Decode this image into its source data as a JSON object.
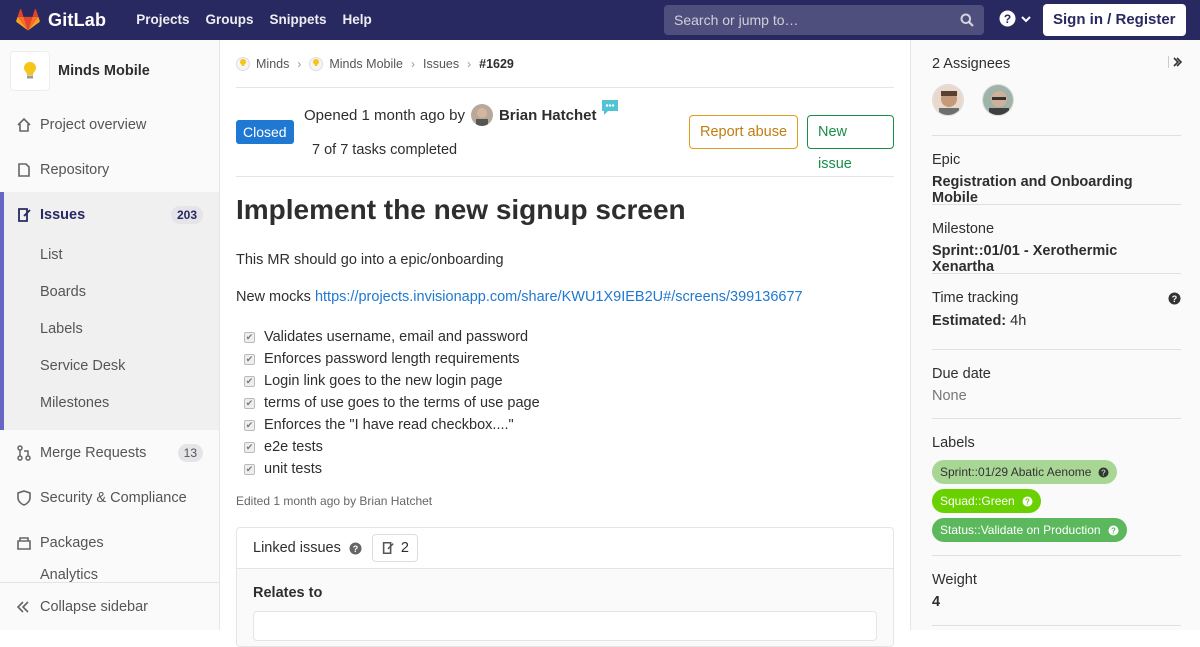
{
  "topbar": {
    "brand": "GitLab",
    "nav": [
      "Projects",
      "Groups",
      "Snippets",
      "Help"
    ],
    "search_placeholder": "Search or jump to…",
    "signin": "Sign in / Register"
  },
  "sidebar": {
    "project_name": "Minds Mobile",
    "items": [
      {
        "label": "Project overview",
        "icon": "home-icon"
      },
      {
        "label": "Repository",
        "icon": "doc-icon"
      }
    ],
    "issues": {
      "label": "Issues",
      "count": "203",
      "sub": [
        "List",
        "Boards",
        "Labels",
        "Service Desk",
        "Milestones"
      ]
    },
    "items_after": [
      {
        "label": "Merge Requests",
        "count": "13",
        "icon": "merge-request-icon"
      },
      {
        "label": "Security & Compliance",
        "icon": "shield-icon"
      },
      {
        "label": "Packages",
        "icon": "package-icon"
      }
    ],
    "partial_label": "Analytics",
    "collapse": "Collapse sidebar"
  },
  "breadcrumb": [
    "Minds",
    "Minds Mobile",
    "Issues",
    "#1629"
  ],
  "issue": {
    "status": "Closed",
    "opened_prefix": "Opened 1 month ago by",
    "author": "Brian Hatchet",
    "tasks": "7 of 7 tasks completed",
    "report_abuse": "Report abuse",
    "new_issue": "New issue",
    "title": "Implement the new signup screen",
    "desc1": "This MR should go into a epic/onboarding",
    "desc2_prefix": "New mocks ",
    "desc2_link": "https://projects.invisionapp.com/share/KWU1X9IEB2U#/screens/399136677",
    "task_items": [
      "Validates username, email and password",
      "Enforces password length requirements",
      "Login link goes to the new login page",
      "terms of use goes to the terms of use page",
      "Enforces the \"I have read checkbox....\"",
      "e2e tests",
      "unit tests"
    ],
    "edited": "Edited 1 month ago by Brian Hatchet",
    "linked_label": "Linked issues",
    "linked_count": "2",
    "relates_to": "Relates to"
  },
  "right": {
    "assignees": "2 Assignees",
    "epic_title": "Epic",
    "epic_value": "Registration and Onboarding Mobile",
    "milestone_title": "Milestone",
    "milestone_value": "Sprint::01/01 - Xerothermic Xenartha",
    "time_title": "Time tracking",
    "estimated_label": "Estimated:",
    "estimated_value": "4h",
    "due_title": "Due date",
    "due_value": "None",
    "labels_title": "Labels",
    "labels": [
      {
        "text": "Sprint::01/29 Abatic Aenome",
        "color": "#a8d695",
        "fg": "#333333"
      },
      {
        "text": "Squad::Green",
        "color": "#69d100",
        "fg": "#ffffff"
      },
      {
        "text": "Status::Validate on Production",
        "color": "#5cb85c",
        "fg": "#ffffff"
      }
    ],
    "weight_title": "Weight",
    "weight_value": "4"
  }
}
